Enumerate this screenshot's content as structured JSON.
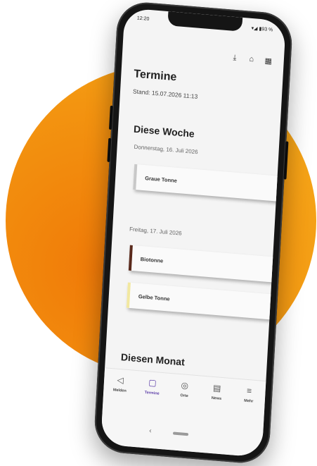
{
  "status_bar": {
    "time": "12:20",
    "indicators": "▾◢ ▮93 %"
  },
  "toolbar": {
    "icons": [
      {
        "name": "download-icon",
        "glyph": "⤓"
      },
      {
        "name": "home-icon",
        "glyph": "⌂"
      },
      {
        "name": "calendar-grid-icon",
        "glyph": "▦"
      }
    ]
  },
  "page": {
    "title": "Termine",
    "updated": "Stand: 15.07.2026 11:13"
  },
  "week": {
    "title": "Diese Woche",
    "days": [
      {
        "label": "Donnerstag, 16. Juli 2026",
        "items": [
          {
            "label": "Graue Tonne",
            "color": "#c8c8c8"
          }
        ]
      },
      {
        "label": "Freitag, 17. Juli 2026",
        "items": [
          {
            "label": "Biotonne",
            "color": "#5a2a1c"
          },
          {
            "label": "Gelbe Tonne",
            "color": "#f2e8a0"
          }
        ]
      }
    ]
  },
  "month": {
    "title": "Diesen Monat"
  },
  "bottom_nav": [
    {
      "label": "Melden",
      "icon": "megaphone-icon",
      "glyph": "◁",
      "active": false
    },
    {
      "label": "Termine",
      "icon": "calendar-icon",
      "glyph": "▢",
      "active": true
    },
    {
      "label": "Orte",
      "icon": "location-pin-icon",
      "glyph": "◎",
      "active": false
    },
    {
      "label": "News",
      "icon": "news-icon",
      "glyph": "▤",
      "active": false
    },
    {
      "label": "Mehr",
      "icon": "menu-icon",
      "glyph": "≡",
      "active": false
    }
  ],
  "system_nav": {
    "back_glyph": "‹"
  },
  "colors": {
    "accent": "#5c3da8",
    "background_disc": "#f39410"
  }
}
